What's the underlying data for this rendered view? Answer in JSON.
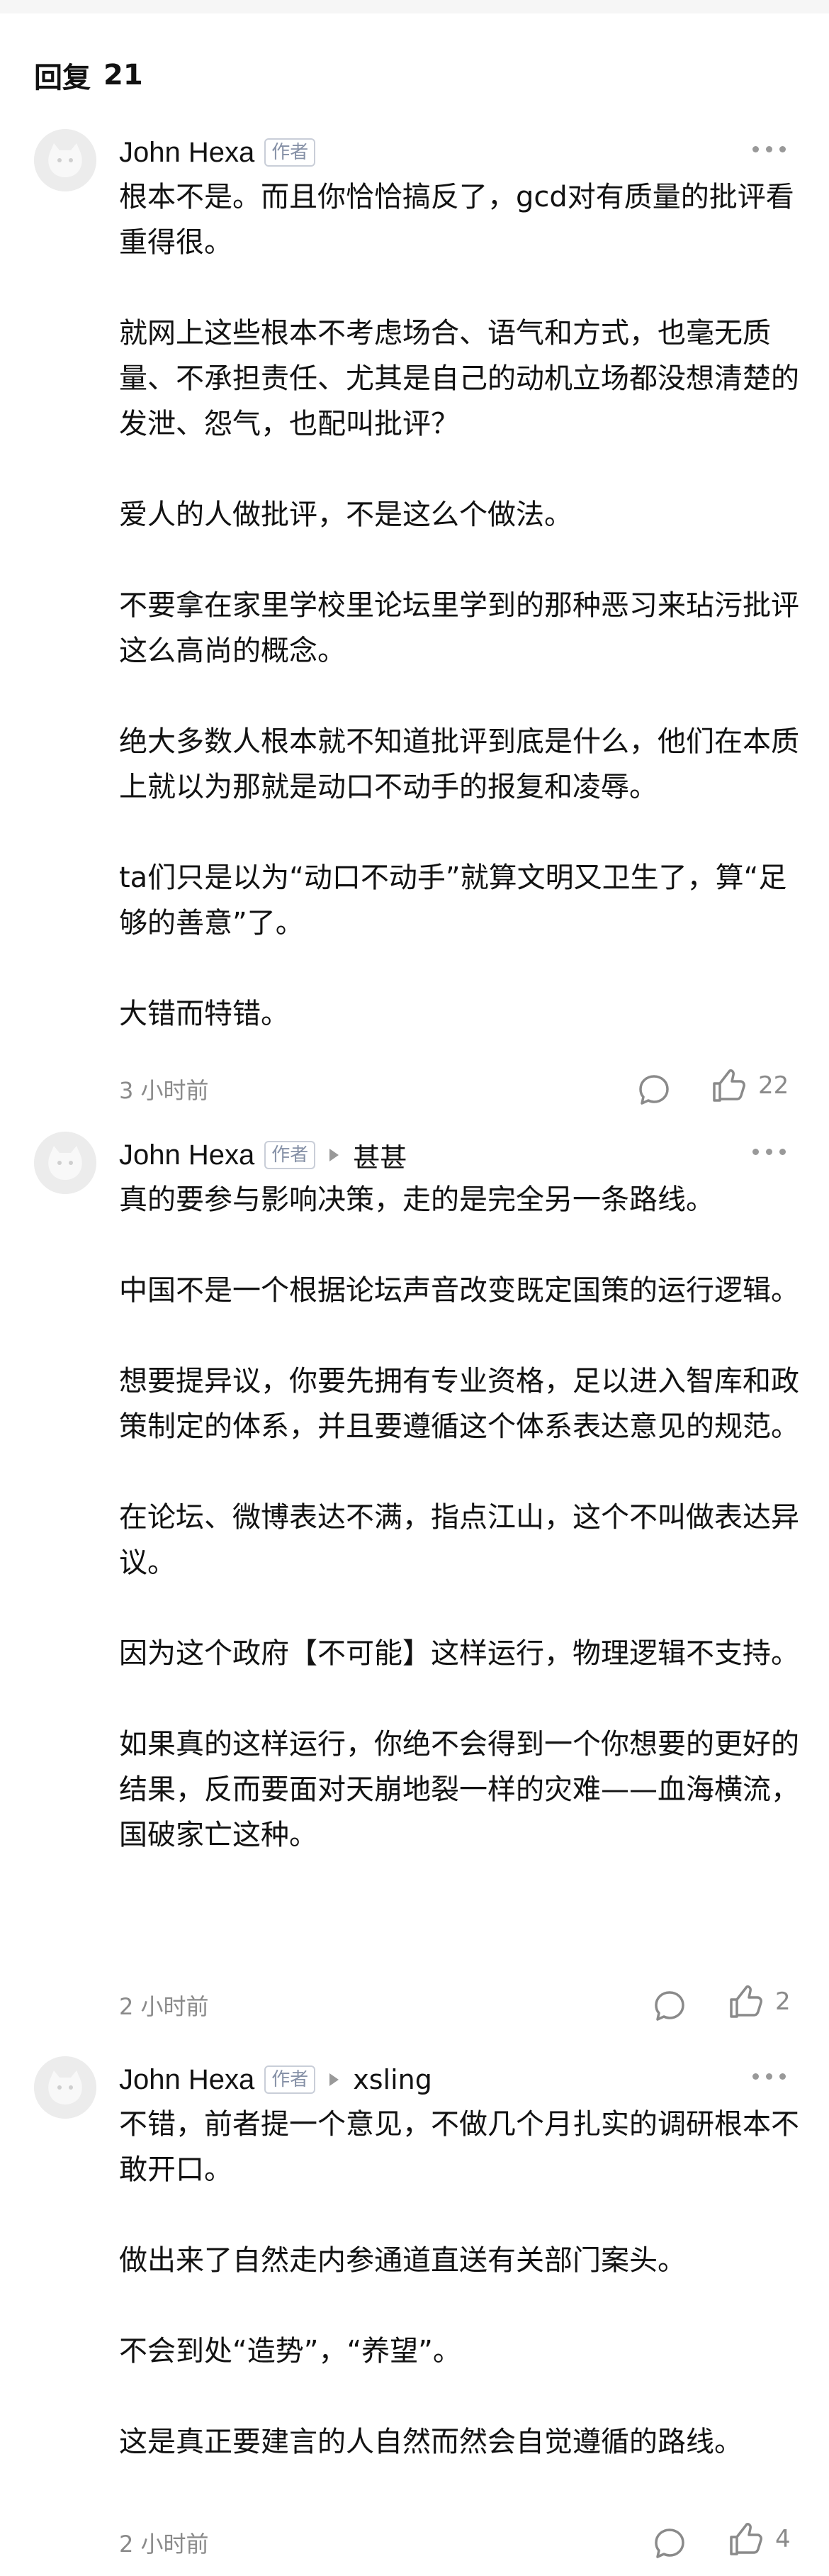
{
  "header": {
    "label": "回复",
    "count": "21"
  },
  "comments": [
    {
      "author": "John Hexa",
      "badge": "作者",
      "reply_to": "",
      "paragraphs": [
        "根本不是。而且你恰恰搞反了，gcd对有质量的批评看重得很。",
        "就网上这些根本不考虑场合、语气和方式，也毫无质量、不承担责任、尤其是自己的动机立场都没想清楚的发泄、怨气，也配叫批评？",
        "爱人的人做批评，不是这么个做法。",
        "不要拿在家里学校里论坛里学到的那种恶习来玷污批评这么高尚的概念。",
        "绝大多数人根本就不知道批评到底是什么，他们在本质上就以为那就是动口不动手的报复和凌辱。",
        "ta们只是以为“动口不动手”就算文明又卫生了，算“足够的善意”了。",
        "大错而特错。"
      ],
      "time": "3 小时前",
      "likes": "22"
    },
    {
      "author": "John Hexa",
      "badge": "作者",
      "reply_to": "甚甚",
      "paragraphs": [
        "真的要参与影响决策，走的是完全另一条路线。",
        "中国不是一个根据论坛声音改变既定国策的运行逻辑。",
        "想要提异议，你要先拥有专业资格，足以进入智库和政策制定的体系，并且要遵循这个体系表达意见的规范。",
        "在论坛、微博表达不满，指点江山，这个不叫做表达异议。",
        "因为这个政府【不可能】这样运行，物理逻辑不支持。",
        "如果真的这样运行，你绝不会得到一个你想要的更好的结果，反而要面对天崩地裂一样的灾难——血海横流，国破家亡这种。"
      ],
      "time": "2 小时前",
      "likes": "2"
    },
    {
      "author": "John Hexa",
      "badge": "作者",
      "reply_to": "xsling",
      "paragraphs": [
        "不错，前者提一个意见，不做几个月扎实的调研根本不敢开口。",
        "做出来了自然走内参通道直送有关部门案头。",
        "不会到处“造势”，“养望”。",
        "这是真正要建言的人自然而然会自觉遵循的路线。"
      ],
      "time": "2 小时前",
      "likes": "4"
    }
  ],
  "icons": {
    "avatar": "cat-avatar-icon",
    "more": "more-dots-icon",
    "comment": "comment-bubble-icon",
    "like": "thumbs-up-icon",
    "reply": "reply-arrow-icon"
  },
  "colors": {
    "text": "#121212",
    "muted": "#8a8a8a",
    "badge": "#8590a6"
  }
}
